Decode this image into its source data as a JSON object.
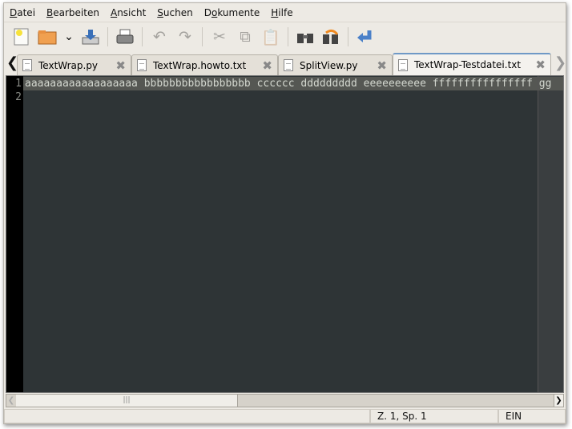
{
  "menu": [
    "Datei",
    "Bearbeiten",
    "Ansicht",
    "Suchen",
    "Dokumente",
    "Hilfe"
  ],
  "menu_mnemonic_index": [
    0,
    0,
    0,
    0,
    1,
    0
  ],
  "toolbar": {
    "new": "new-document-icon",
    "open": "open-folder-icon",
    "recent": "chevron-down-icon",
    "save": "save-icon",
    "print": "print-icon",
    "undo": "undo-icon",
    "redo": "redo-icon",
    "cut": "cut-icon",
    "copy": "copy-icon",
    "paste": "paste-icon",
    "find": "binoculars-icon",
    "replace": "find-replace-icon",
    "jump": "goto-line-icon"
  },
  "tabs": [
    {
      "label": "TextWrap.py"
    },
    {
      "label": "TextWrap.howto.txt"
    },
    {
      "label": "SplitView.py"
    },
    {
      "label": "TextWrap-Testdatei.txt",
      "active": true
    }
  ],
  "editor": {
    "line_numbers": [
      "1",
      "2"
    ],
    "lines": [
      "aaaaaaaaaaaaaaaaaa bbbbbbbbbbbbbbbbb cccccc ddddddddd eeeeeeeeee ffffffffffffffff gg",
      ""
    ]
  },
  "status": {
    "position": "Z. 1, Sp. 1",
    "mode": "EIN"
  },
  "colors": {
    "editor_bg": "#2e3436",
    "current_line": "#555753",
    "tab_accent": "#6f99c6"
  }
}
